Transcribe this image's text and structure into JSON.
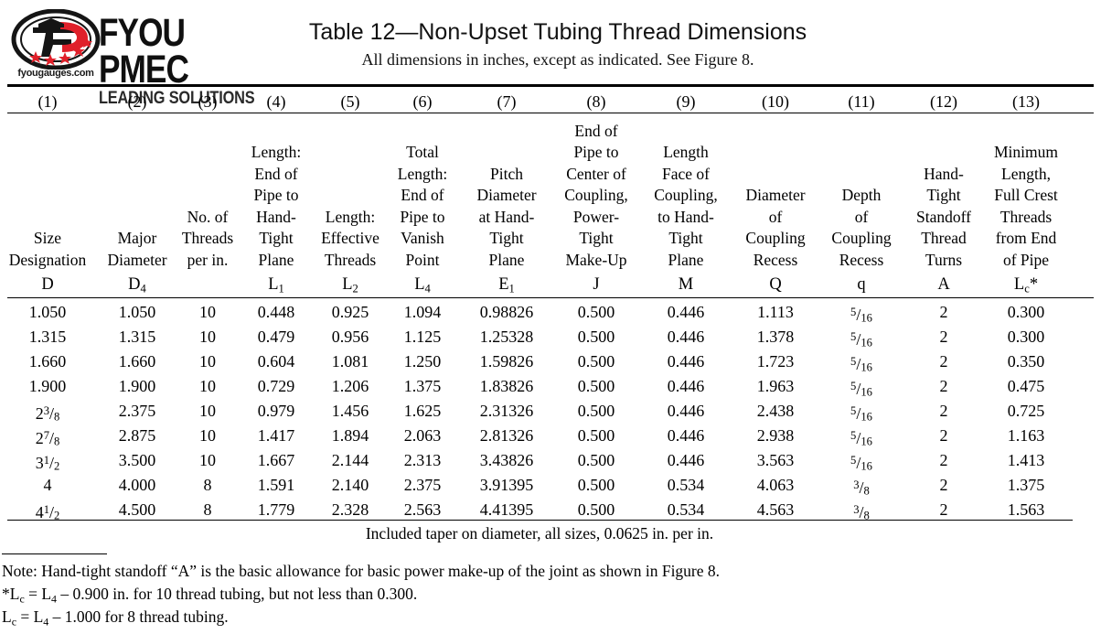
{
  "brand": {
    "emblem_icon": "fyou-emblem-icon",
    "domain_text": "fyougauges.com",
    "wordmark": "FYOU PMEC",
    "tagline": "LEADING SOLUTIONS",
    "accent_color": "#e0202a",
    "dark_color": "#101010"
  },
  "title": "Table  12—Non-Upset Tubing Thread Dimensions",
  "subtitle": "All dimensions in inches, except as indicated. See Figure 8.",
  "column_numbers": [
    "(1)",
    "(2)",
    "(3)",
    "(4)",
    "(5)",
    "(6)",
    "(7)",
    "(8)",
    "(9)",
    "(10)",
    "(11)",
    "(12)",
    "(13)"
  ],
  "headers": [
    {
      "lines": [
        "Size",
        "Designation"
      ],
      "symbol": "D"
    },
    {
      "lines": [
        "Major",
        "Diameter"
      ],
      "symbol": "D₄"
    },
    {
      "lines": [
        "No. of",
        "Threads",
        "per in."
      ],
      "symbol": ""
    },
    {
      "lines": [
        "Length:",
        "End of",
        "Pipe to",
        "Hand-",
        "Tight",
        "Plane"
      ],
      "symbol": "L₁"
    },
    {
      "lines": [
        "Length:",
        "Effective",
        "Threads"
      ],
      "symbol": "L₂"
    },
    {
      "lines": [
        "Total",
        "Length:",
        "End of",
        "Pipe to",
        "Vanish",
        "Point"
      ],
      "symbol": "L₄"
    },
    {
      "lines": [
        "Pitch",
        "Diameter",
        "at Hand-",
        "Tight",
        "Plane"
      ],
      "symbol": "E₁"
    },
    {
      "lines": [
        "End of",
        "Pipe to",
        "Center of",
        "Coupling,",
        "Power-",
        "Tight",
        "Make-Up"
      ],
      "symbol": "J"
    },
    {
      "lines": [
        "Length",
        "Face of",
        "Coupling,",
        "to Hand-",
        "Tight",
        "Plane"
      ],
      "symbol": "M"
    },
    {
      "lines": [
        "Diameter",
        "of",
        "Coupling",
        "Recess"
      ],
      "symbol": "Q"
    },
    {
      "lines": [
        "Depth",
        "of",
        "Coupling",
        "Recess"
      ],
      "symbol": "q"
    },
    {
      "lines": [
        "Hand-",
        "Tight",
        "Standoff",
        "Thread",
        "Turns"
      ],
      "symbol": "A"
    },
    {
      "lines": [
        "Minimum",
        "Length,",
        "Full Crest",
        "Threads",
        "from End",
        "of Pipe"
      ],
      "symbol": "Lᴄ*"
    }
  ],
  "rows": [
    {
      "size_whole": "1.050",
      "size_num": "",
      "size_den": "",
      "d4": "1.050",
      "threads": "10",
      "l1": "0.448",
      "l2": "0.925",
      "l4": "1.094",
      "e1": "0.98826",
      "j": "0.500",
      "m": "0.446",
      "q_cap": "1.113",
      "q_num": "5",
      "q_den": "16",
      "a": "2",
      "lc": "0.300"
    },
    {
      "size_whole": "1.315",
      "size_num": "",
      "size_den": "",
      "d4": "1.315",
      "threads": "10",
      "l1": "0.479",
      "l2": "0.956",
      "l4": "1.125",
      "e1": "1.25328",
      "j": "0.500",
      "m": "0.446",
      "q_cap": "1.378",
      "q_num": "5",
      "q_den": "16",
      "a": "2",
      "lc": "0.300"
    },
    {
      "size_whole": "1.660",
      "size_num": "",
      "size_den": "",
      "d4": "1.660",
      "threads": "10",
      "l1": "0.604",
      "l2": "1.081",
      "l4": "1.250",
      "e1": "1.59826",
      "j": "0.500",
      "m": "0.446",
      "q_cap": "1.723",
      "q_num": "5",
      "q_den": "16",
      "a": "2",
      "lc": "0.350"
    },
    {
      "size_whole": "1.900",
      "size_num": "",
      "size_den": "",
      "d4": "1.900",
      "threads": "10",
      "l1": "0.729",
      "l2": "1.206",
      "l4": "1.375",
      "e1": "1.83826",
      "j": "0.500",
      "m": "0.446",
      "q_cap": "1.963",
      "q_num": "5",
      "q_den": "16",
      "a": "2",
      "lc": "0.475"
    },
    {
      "size_whole": "2",
      "size_num": "3",
      "size_den": "8",
      "d4": "2.375",
      "threads": "10",
      "l1": "0.979",
      "l2": "1.456",
      "l4": "1.625",
      "e1": "2.31326",
      "j": "0.500",
      "m": "0.446",
      "q_cap": "2.438",
      "q_num": "5",
      "q_den": "16",
      "a": "2",
      "lc": "0.725"
    },
    {
      "size_whole": "2",
      "size_num": "7",
      "size_den": "8",
      "d4": "2.875",
      "threads": "10",
      "l1": "1.417",
      "l2": "1.894",
      "l4": "2.063",
      "e1": "2.81326",
      "j": "0.500",
      "m": "0.446",
      "q_cap": "2.938",
      "q_num": "5",
      "q_den": "16",
      "a": "2",
      "lc": "1.163"
    },
    {
      "size_whole": "3",
      "size_num": "1",
      "size_den": "2",
      "d4": "3.500",
      "threads": "10",
      "l1": "1.667",
      "l2": "2.144",
      "l4": "2.313",
      "e1": "3.43826",
      "j": "0.500",
      "m": "0.446",
      "q_cap": "3.563",
      "q_num": "5",
      "q_den": "16",
      "a": "2",
      "lc": "1.413"
    },
    {
      "size_whole": "4",
      "size_num": "",
      "size_den": "",
      "d4": "4.000",
      "threads": "8",
      "l1": "1.591",
      "l2": "2.140",
      "l4": "2.375",
      "e1": "3.91395",
      "j": "0.500",
      "m": "0.534",
      "q_cap": "4.063",
      "q_num": "3",
      "q_den": "8",
      "a": "2",
      "lc": "1.375"
    },
    {
      "size_whole": "4",
      "size_num": "1",
      "size_den": "2",
      "d4": "4.500",
      "threads": "8",
      "l1": "1.779",
      "l2": "2.328",
      "l4": "2.563",
      "e1": "4.41395",
      "j": "0.500",
      "m": "0.534",
      "q_cap": "4.563",
      "q_num": "3",
      "q_den": "8",
      "a": "2",
      "lc": "1.563"
    }
  ],
  "taper_note": "Included taper on diameter, all sizes, 0.0625 in. per in.",
  "notes": [
    "Note: Hand-tight standoff “A” is the basic allowance for basic power make-up of the joint as shown in Figure 8.",
    "*Lᴄ = L₄ – 0.900 in. for 10 thread tubing, but not less than 0.300.",
    "Lᴄ = L₄ – 1.000 for 8 thread tubing."
  ]
}
